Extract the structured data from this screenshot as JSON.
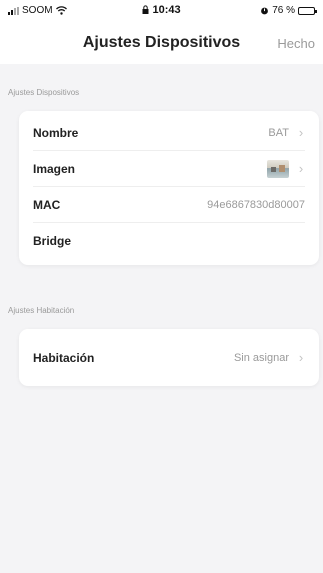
{
  "status_bar": {
    "carrier": "SOOM",
    "time": "10:43",
    "battery_text": "76 %",
    "battery_level_percent": 76
  },
  "navbar": {
    "title": "Ajustes Dispositivos",
    "done_label": "Hecho"
  },
  "device_section": {
    "header": "Ajustes Dispositivos",
    "rows": [
      {
        "label": "Nombre",
        "value": "BAT"
      },
      {
        "label": "Imagen",
        "value": ""
      },
      {
        "label": "MAC",
        "value": "94e6867830d80007"
      },
      {
        "label": "Bridge",
        "value": ""
      }
    ]
  },
  "room_section": {
    "header": "Ajustes Habitación",
    "rows": [
      {
        "label": "Habitación",
        "value": "Sin asignar"
      }
    ]
  },
  "icons": {
    "signal": "cellular-signal-icon",
    "wifi": "wifi-icon",
    "lock": "lock-icon",
    "alarm": "alarm-icon",
    "battery": "battery-icon",
    "chevron": "chevron-right-icon"
  }
}
